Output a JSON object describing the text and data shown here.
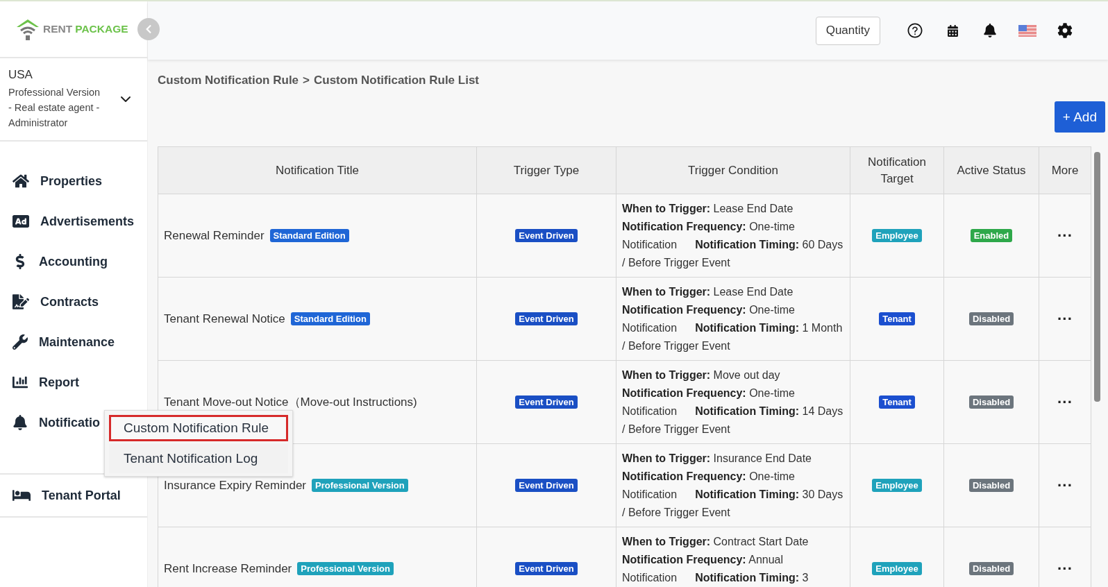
{
  "logo": {
    "part_1": "RENT",
    "part_2": "PACKAGE"
  },
  "header": {
    "quantity_button": "Quantity"
  },
  "account": {
    "country": "USA",
    "details": "Professional Version - Real estate agent - Administrator"
  },
  "nav": {
    "items": [
      {
        "label": "Properties",
        "kind": "home"
      },
      {
        "label": "Advertisements",
        "kind": "ad"
      },
      {
        "label": "Accounting",
        "kind": "dollar"
      },
      {
        "label": "Contracts",
        "kind": "contract"
      },
      {
        "label": "Maintenance",
        "kind": "wrench"
      },
      {
        "label": "Report",
        "kind": "chart"
      },
      {
        "label": "Notificatio",
        "kind": "bell"
      }
    ],
    "portal": {
      "label": "Tenant Portal"
    }
  },
  "submenu": [
    {
      "label": "Custom Notification Rule",
      "selected": true
    },
    {
      "label": "Tenant Notification Log",
      "selected": false
    }
  ],
  "breadcrumb": {
    "parent": "Custom Notification Rule",
    "separator": ">",
    "current": "Custom Notification Rule List"
  },
  "add_button": "+ Add",
  "table": {
    "columns": [
      "Notification Title",
      "Trigger Type",
      "Trigger Condition",
      "Notification Target",
      "Active Status",
      "More"
    ],
    "rows": [
      {
        "title": "Renewal Reminder",
        "edition": {
          "label": "Standard Edition",
          "color": "#1f66d6"
        },
        "trigger_type": "Event Driven",
        "condition": [
          "**When to Trigger:** Lease End Date",
          "**Notification Frequency:** One-time Notification",
          "**Notification Timing:** 60 Days / Before Trigger Event"
        ],
        "target": {
          "label": "Employee",
          "color": "#1fa2bb"
        },
        "status": {
          "label": "Enabled",
          "on": true
        },
        "more": "···"
      },
      {
        "title": "Tenant Renewal Notice",
        "edition": {
          "label": "Standard Edition",
          "color": "#1f66d6"
        },
        "trigger_type": "Event Driven",
        "condition": [
          "**When to Trigger:** Lease End Date",
          "**Notification Frequency:** One-time Notification",
          "**Notification Timing:** 1 Month / Before Trigger Event"
        ],
        "target": {
          "label": "Tenant",
          "color": "#1b4fcf"
        },
        "status": {
          "label": "Disabled",
          "on": false
        },
        "more": "···"
      },
      {
        "title": "Tenant Move-out Notice（Move-out Instructions)",
        "trigger_type": "Event Driven",
        "condition": [
          "**When to Trigger:** Move out day",
          "**Notification Frequency:** One-time Notification",
          "**Notification Timing:** 14 Days / Before Trigger Event"
        ],
        "target": {
          "label": "Tenant",
          "color": "#1b4fcf"
        },
        "status": {
          "label": "Disabled",
          "on": false
        },
        "more": "···"
      },
      {
        "title": "Insurance Expiry Reminder",
        "edition": {
          "label": "Professional Version",
          "color": "#1fa2bb"
        },
        "trigger_type": "Event Driven",
        "condition": [
          "**When to Trigger:** Insurance End Date",
          "**Notification Frequency:** One-time Notification",
          "**Notification Timing:** 30 Days / Before Trigger Event"
        ],
        "target": {
          "label": "Employee",
          "color": "#1fa2bb"
        },
        "status": {
          "label": "Disabled",
          "on": false
        },
        "more": "···"
      },
      {
        "title": "Rent Increase Reminder",
        "edition": {
          "label": "Professional Version",
          "color": "#1fa2bb"
        },
        "trigger_type": "Event Driven",
        "condition": [
          "**When to Trigger:** Contract Start Date",
          "**Notification Frequency:** Annual Notification",
          "**Notification Timing:** 3"
        ],
        "target": {
          "label": "Employee",
          "color": "#1fa2bb"
        },
        "status": {
          "label": "Disabled",
          "on": false
        },
        "more": "···"
      }
    ]
  }
}
